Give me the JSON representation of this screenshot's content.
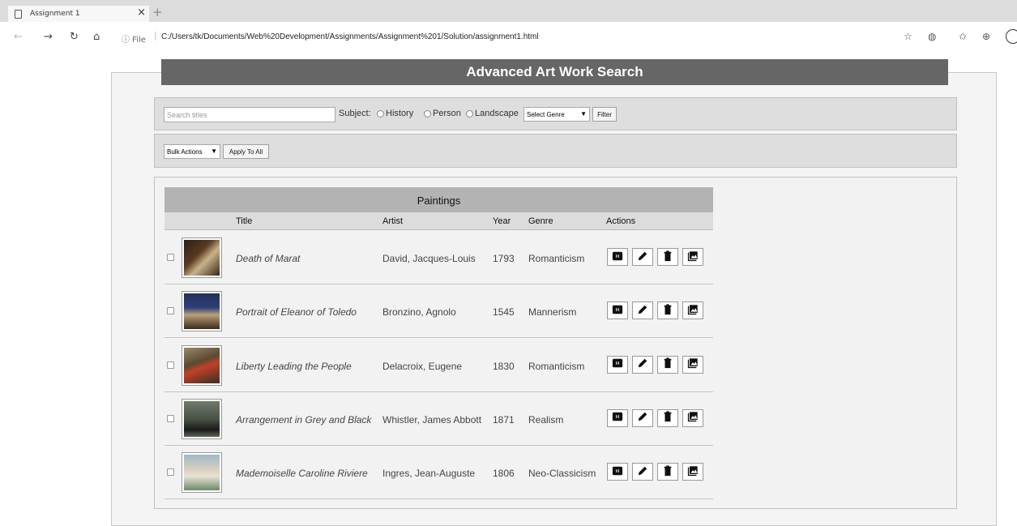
{
  "browser": {
    "tab_title": "Assignment 1",
    "tab_close": "×",
    "new_tab": "+",
    "info": "ⓘ File",
    "url": "C:/Users/tk/Documents/Web%20Development/Assignments/Assignment%201/Solution/assignment1.html"
  },
  "page": {
    "title": "Advanced Art Work Search"
  },
  "filter": {
    "search_placeholder": "Search titles",
    "subject_label": "Subject:",
    "radios": [
      "History",
      "Person",
      "Landscape"
    ],
    "genre_select": "Select Genre",
    "filter_button": "Filter"
  },
  "bulk": {
    "select": "Bulk Actions",
    "apply_button": "Apply To All"
  },
  "table": {
    "caption": "Paintings",
    "headers": {
      "title": "Title",
      "artist": "Artist",
      "year": "Year",
      "genre": "Genre",
      "actions": "Actions"
    },
    "rows": [
      {
        "title": "Death of Marat",
        "artist": "David, Jacques-Louis",
        "year": "1793",
        "genre": "Romanticism"
      },
      {
        "title": "Portrait of Eleanor of Toledo",
        "artist": "Bronzino, Agnolo",
        "year": "1545",
        "genre": "Mannerism"
      },
      {
        "title": "Liberty Leading the People",
        "artist": "Delacroix, Eugene",
        "year": "1830",
        "genre": "Romanticism"
      },
      {
        "title": "Arrangement in Grey and Black",
        "artist": "Whistler, James Abbott",
        "year": "1871",
        "genre": "Realism"
      },
      {
        "title": "Mademoiselle Caroline Riviere",
        "artist": "Ingres, Jean-Auguste",
        "year": "1806",
        "genre": "Neo-Classicism"
      }
    ]
  },
  "icons": {
    "actions": [
      "add-to-favorites-icon",
      "edit-icon",
      "delete-icon",
      "view-image-icon"
    ]
  },
  "colors": {
    "title_bar": "#666666",
    "caption_bar": "#b3b3b3",
    "panel": "#dedede"
  }
}
